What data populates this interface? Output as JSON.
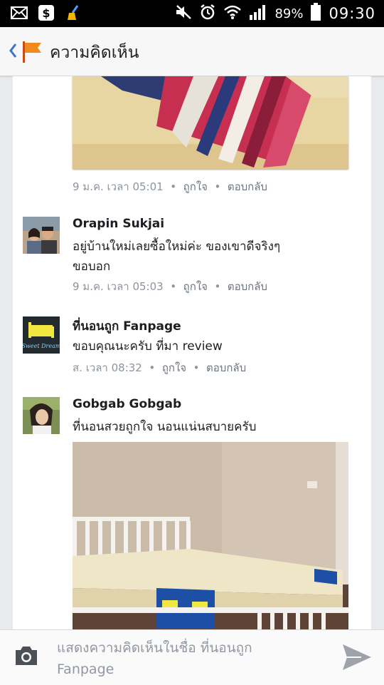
{
  "status_bar": {
    "battery": "89%",
    "time": "09:30",
    "icons": [
      "mail-icon",
      "s-app-icon",
      "broom-icon",
      "mute-icon",
      "alarm-icon",
      "wifi-icon",
      "signal-icon",
      "battery-icon"
    ]
  },
  "header": {
    "title": "ความคิดเห็น",
    "back_icon": "chevron-left-icon",
    "page_icon": "flag-icon",
    "accent": "#3b74c9"
  },
  "feed": {
    "first_meta": {
      "time": "9 ม.ค. เวลา 05:01",
      "sep": "•",
      "like": "ถูกใจ",
      "reply": "ตอบกลับ"
    },
    "comments": [
      {
        "name": "Orapin Sukjai",
        "lines": [
          "อยู่บ้านใหม่เลยซื้อใหม่ค่ะ ของเขาดีจริงๆ",
          "ขอบอก"
        ],
        "time": "9 ม.ค. เวลา 05:03",
        "like": "ถูกใจ",
        "reply": "ตอบกลับ"
      },
      {
        "name": "ที่นอนถูก Fanpage",
        "lines": [
          "ขอบคุณนะครับ ที่มา review"
        ],
        "time": "ส. เวลา 08:32",
        "like": "ถูกใจ",
        "reply": "ตอบกลับ",
        "avatar_text": "Sweet Dream"
      },
      {
        "name": "Gobgab Gobgab",
        "lines": [
          "ที่นอนสวยถูกใจ นอนแน่นสบายครับ"
        ]
      }
    ]
  },
  "composer": {
    "placeholder_line1": "แสดงความคิดเห็นในชื่อ ที่นอนถูก",
    "placeholder_line2": "Fanpage",
    "camera_icon": "camera-icon",
    "send_icon": "send-icon"
  }
}
